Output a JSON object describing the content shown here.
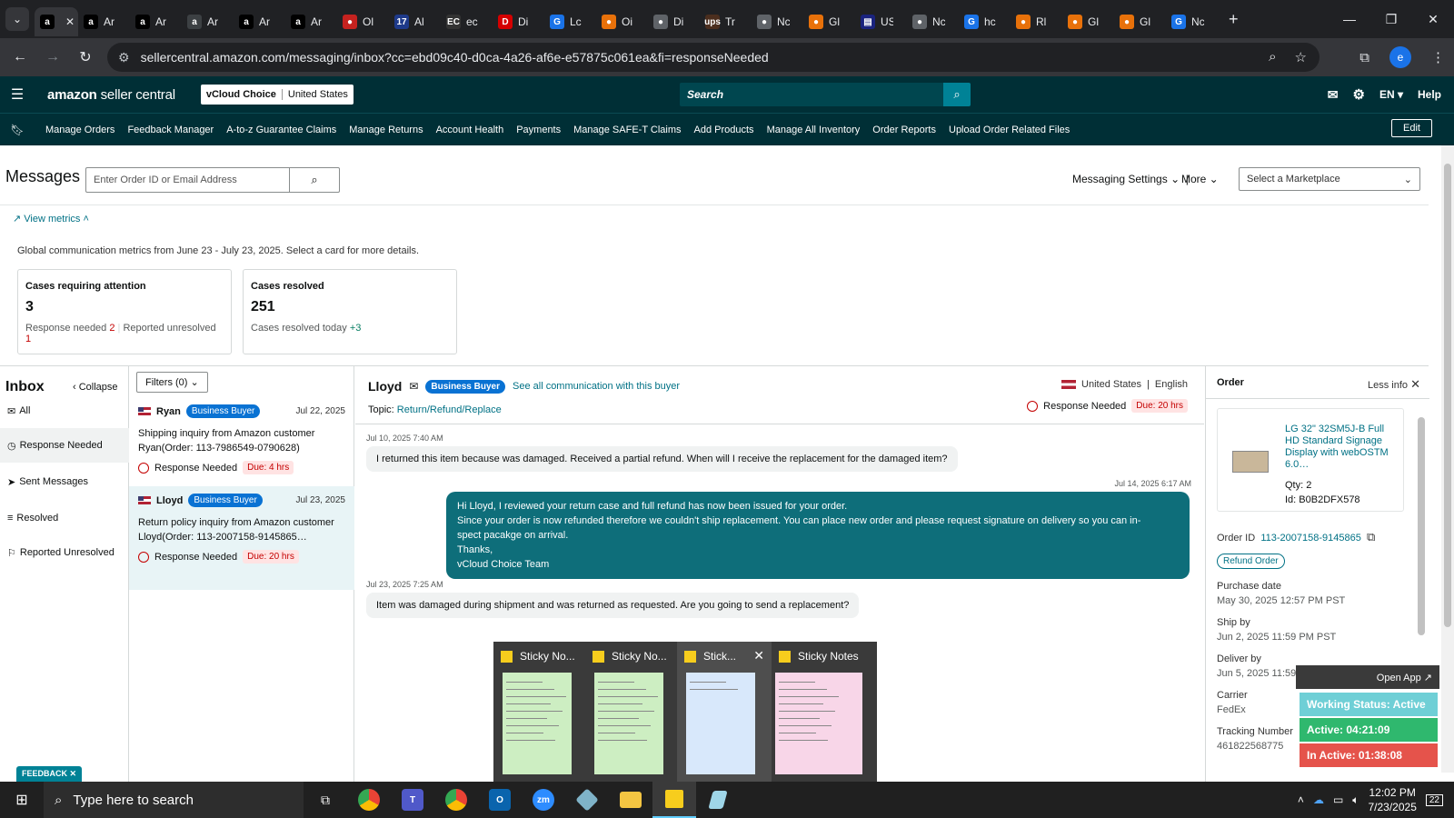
{
  "browser": {
    "tabs": [
      {
        "fav": "a",
        "color": "#000000",
        "title": "",
        "active": true
      },
      {
        "fav": "a",
        "color": "#000000",
        "title": "Ar"
      },
      {
        "fav": "a",
        "color": "#000000",
        "title": "Ar"
      },
      {
        "fav": "a",
        "color": "#3c4043",
        "title": "Ar"
      },
      {
        "fav": "a",
        "color": "#000000",
        "title": "Ar"
      },
      {
        "fav": "a",
        "color": "#000000",
        "title": "Ar"
      },
      {
        "fav": "●",
        "color": "#c5221f",
        "title": "Ol"
      },
      {
        "fav": "17",
        "color": "#1e3a8a",
        "title": "Al"
      },
      {
        "fav": "EC",
        "color": "#333333",
        "title": "ec"
      },
      {
        "fav": "D",
        "color": "#d50000",
        "title": "Di"
      },
      {
        "fav": "G",
        "color": "#1a73e8",
        "title": "Lc"
      },
      {
        "fav": "●",
        "color": "#e8710a",
        "title": "Oi"
      },
      {
        "fav": "●",
        "color": "#5f6368",
        "title": "Di"
      },
      {
        "fav": "ups",
        "color": "#4b2e1e",
        "title": "Tr"
      },
      {
        "fav": "●",
        "color": "#5f6368",
        "title": "Nc"
      },
      {
        "fav": "●",
        "color": "#e8710a",
        "title": "Gl"
      },
      {
        "fav": "▤",
        "color": "#1a237e",
        "title": "US"
      },
      {
        "fav": "●",
        "color": "#5f6368",
        "title": "Nc"
      },
      {
        "fav": "G",
        "color": "#1a73e8",
        "title": "hc"
      },
      {
        "fav": "●",
        "color": "#e8710a",
        "title": "Rl"
      },
      {
        "fav": "●",
        "color": "#e8710a",
        "title": "Gl"
      },
      {
        "fav": "●",
        "color": "#e8710a",
        "title": "Gl"
      },
      {
        "fav": "G",
        "color": "#1a73e8",
        "title": "Nc"
      }
    ],
    "url": "sellercentral.amazon.com/messaging/inbox?cc=ebd09c40-d0ca-4a26-af6e-e57875c061ea&fi=responseNeeded",
    "profile_initial": "e"
  },
  "header": {
    "logo_main": "amazon",
    "logo_sub": " seller central",
    "store_name": "vCloud Choice",
    "store_region": "United States",
    "search_placeholder": "Search",
    "language": "EN",
    "help": "Help"
  },
  "nav": {
    "items": [
      "Manage Orders",
      "Feedback Manager",
      "A-to-z Guarantee Claims",
      "Manage Returns",
      "Account Health",
      "Payments",
      "Manage SAFE-T Claims",
      "Add Products",
      "Manage All Inventory",
      "Order Reports",
      "Upload Order Related Files"
    ],
    "edit": "Edit"
  },
  "messages": {
    "title": "Messages",
    "search_placeholder": "Enter Order ID or Email Address",
    "settings": "Messaging Settings",
    "more": "More",
    "marketplace_placeholder": "Select a Marketplace"
  },
  "metrics": {
    "toggle": "View metrics",
    "caption": "Global communication metrics from June 23 - July 23, 2025. Select a card for more details.",
    "cards": [
      {
        "title": "Cases requiring attention",
        "value": "3",
        "sub1_label": "Response needed ",
        "sub1_value": "2",
        "sub2_label": "Reported unresolved ",
        "sub2_value": "1"
      },
      {
        "title": "Cases resolved",
        "value": "251",
        "sub1_label": "Cases resolved today ",
        "sub1_value": "+3"
      }
    ]
  },
  "inbox": {
    "title": "Inbox",
    "collapse": "Collapse",
    "filters": "Filters (0)",
    "nav": [
      {
        "icon": "✉",
        "label": "All"
      },
      {
        "icon": "◷",
        "label": "Response Needed"
      },
      {
        "icon": "➤",
        "label": "Sent Messages"
      },
      {
        "icon": "≡",
        "label": "Resolved"
      },
      {
        "icon": "⚐",
        "label": "Reported Unresolved"
      }
    ],
    "conversations": [
      {
        "name": "Ryan",
        "badge": "Business Buyer",
        "date": "Jul 22, 2025",
        "body": "Shipping inquiry from Amazon customer Ryan(Order: 113-7986549-0790628)",
        "status": "Response Needed",
        "due": "Due: 4 hrs"
      },
      {
        "name": "Lloyd",
        "badge": "Business Buyer",
        "date": "Jul 23, 2025",
        "body": "Return policy inquiry from Amazon customer Lloyd(Order: 113-2007158-9145865…",
        "status": "Response Needed",
        "due": "Due: 20 hrs"
      }
    ]
  },
  "thread": {
    "buyer": "Lloyd",
    "badge": "Business Buyer",
    "see_all": "See all communication with this buyer",
    "topic_label": "Topic: ",
    "topic": "Return/Refund/Replace",
    "country": "United States",
    "language": "English",
    "status": "Response Needed",
    "due": "Due: 20 hrs",
    "messages": [
      {
        "time": "Jul 10, 2025 7:40 AM",
        "text": "I returned this item because was damaged.  Received a partial refund.   When will I receive the replacement for the damaged item?"
      },
      {
        "time": "Jul 14, 2025 6:17 AM",
        "lines": [
          "Hi Lloyd, I reviewed your return case and full refund has now been issued for your order.",
          "Since your order is now refunded therefore we couldn't ship replacement. You can place new order and please request signature on delivery so you can in-",
          "spect pacakge on arrival.",
          "Thanks,",
          "vCloud Choice Team"
        ]
      },
      {
        "time": "Jul 23, 2025 7:25 AM",
        "text": "Item was damaged during shipment and was returned as requested.  Are you going to send a replacement?"
      }
    ]
  },
  "order": {
    "title": "Order",
    "less_info": "Less info",
    "product": "LG 32\" 32SM5J-B Full HD Standard Signage Display with webOSTM 6.0…",
    "qty": "Qty: 2",
    "id": "Id: B0B2DFX578",
    "order_id_label": "Order ID",
    "order_id": "113-2007158-9145865",
    "refund": "Refund Order",
    "fields": [
      {
        "label": "Purchase date",
        "value": "May 30, 2025 12:57 PM PST"
      },
      {
        "label": "Ship by",
        "value": "Jun 2, 2025 11:59 PM PST"
      },
      {
        "label": "Deliver by",
        "value": "Jun 5, 2025 11:59 PM PST"
      },
      {
        "label": "Carrier",
        "value": "FedEx"
      },
      {
        "label": "Tracking Number",
        "value": "461822568775"
      }
    ]
  },
  "sticky": {
    "notes": [
      {
        "title": "Sticky No...",
        "bg": "#cdeec2"
      },
      {
        "title": "Sticky No...",
        "bg": "#cdeec2"
      },
      {
        "title": "Stick...",
        "bg": "#d8e8fb"
      },
      {
        "title": "Sticky Notes",
        "bg": "#f8d6e8"
      }
    ]
  },
  "widget": {
    "open_app": "Open App ↗",
    "working_status": "Working Status: Active",
    "active": "Active: 04:21:09",
    "inactive": "In Active: 01:38:08"
  },
  "feedback": "FEEDBACK",
  "taskbar": {
    "search_placeholder": "Type here to search",
    "time": "12:02 PM",
    "date": "7/23/2025",
    "notif_count": "22"
  }
}
